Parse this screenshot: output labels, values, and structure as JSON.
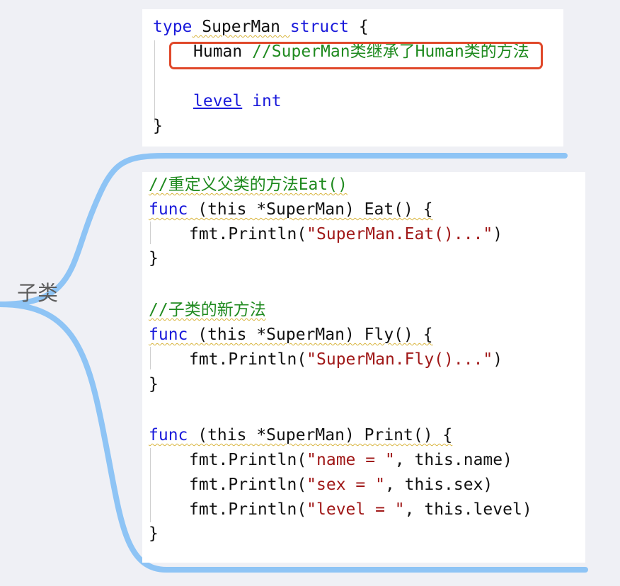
{
  "label": "子类",
  "struct_card": {
    "l1_kw": "type",
    "l1_name": " SuperMan ",
    "l1_kw2": "struct",
    "l1_end": " {",
    "l2_type": "Human ",
    "l2_comment": "//SuperMan类继承了Human类的方法",
    "l3_field": "level",
    "l3_type": "int",
    "l4": "}"
  },
  "methods_card": {
    "eat_comment": "//重定义父类的方法Eat()",
    "eat_kw": "func",
    "eat_sig": " (this *SuperMan) Eat() {",
    "eat_call": "fmt.Println(",
    "eat_str": "\"SuperMan.Eat()...\"",
    "eat_close": ")",
    "brace": "}",
    "fly_comment": "//子类的新方法",
    "fly_kw": "func",
    "fly_sig": " (this *SuperMan) Fly() {",
    "fly_call": "fmt.Println(",
    "fly_str": "\"SuperMan.Fly()...\"",
    "fly_close": ")",
    "print_kw": "func",
    "print_sig": " (this *SuperMan) Print() {",
    "p1_call": "fmt.Println(",
    "p1_str": "\"name = \"",
    "p1_rest": ", this.name)",
    "p2_call": "fmt.Println(",
    "p2_str": "\"sex = \"",
    "p2_rest": ", this.sex)",
    "p3_call": "fmt.Println(",
    "p3_str": "\"level = \"",
    "p3_rest": ", this.level)"
  },
  "colors": {
    "keyword": "#1a1adb",
    "comment": "#1f8a1f",
    "string": "#a01818",
    "branch": "#8ec4f5",
    "highlight": "#e0482a"
  }
}
